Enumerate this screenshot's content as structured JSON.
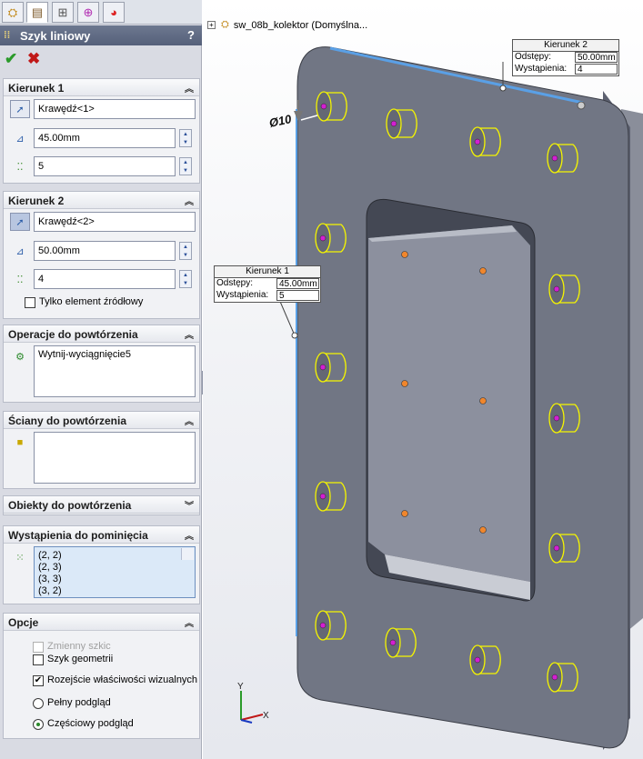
{
  "tabs": [
    "feature-manager",
    "property-manager",
    "configuration-manager",
    "dimxpert-manager",
    "display-manager"
  ],
  "panel": {
    "title": "Szyk liniowy",
    "help": "?"
  },
  "dir1": {
    "title": "Kierunek 1",
    "edge": "Krawędź<1>",
    "spacing": "45.00mm",
    "instances": "5"
  },
  "dir2": {
    "title": "Kierunek 2",
    "edge": "Krawędź<2>",
    "spacing": "50.00mm",
    "instances": "4",
    "seed_only": "Tylko element źródłowy"
  },
  "features": {
    "title": "Operacje do powtórzenia",
    "items": [
      "Wytnij-wyciągnięcie5"
    ]
  },
  "faces": {
    "title": "Ściany do powtórzenia"
  },
  "bodies": {
    "title": "Obiekty do powtórzenia"
  },
  "skip": {
    "title": "Wystąpienia do pominięcia",
    "items": [
      "(2, 2)",
      "(2, 3)",
      "(3, 3)",
      "(3, 2)"
    ]
  },
  "options": {
    "title": "Opcje",
    "variable_sketch": "Zmienny szkic",
    "geometry_pattern": "Szyk geometrii",
    "propagate_visual": "Rozejście właściwości wizualnych",
    "full_preview": "Pełny podgląd",
    "partial_preview": "Częściowy podgląd",
    "geometry_checked": false,
    "propagate_checked": true,
    "preview": "partial"
  },
  "viewport": {
    "tree_item": "sw_08b_kolektor  (Domyślna...",
    "dimension": "Ø10",
    "callout2": {
      "title": "Kierunek 2",
      "spacing_label": "Odstępy:",
      "spacing": "50.00mm",
      "instances_label": "Wystąpienia:",
      "instances": "4"
    },
    "callout1": {
      "title": "Kierunek 1",
      "spacing_label": "Odstępy:",
      "spacing": "45.00mm",
      "instances_label": "Wystąpienia:",
      "instances": "5"
    },
    "triad": {
      "x": "X",
      "y": "Y"
    }
  },
  "colors": {
    "plate": "#717684",
    "hole_outline": "#f5f500",
    "edge_highlight": "#5aa0e6",
    "marker_magenta": "#d21fd2",
    "marker_orange": "#f0862c"
  }
}
